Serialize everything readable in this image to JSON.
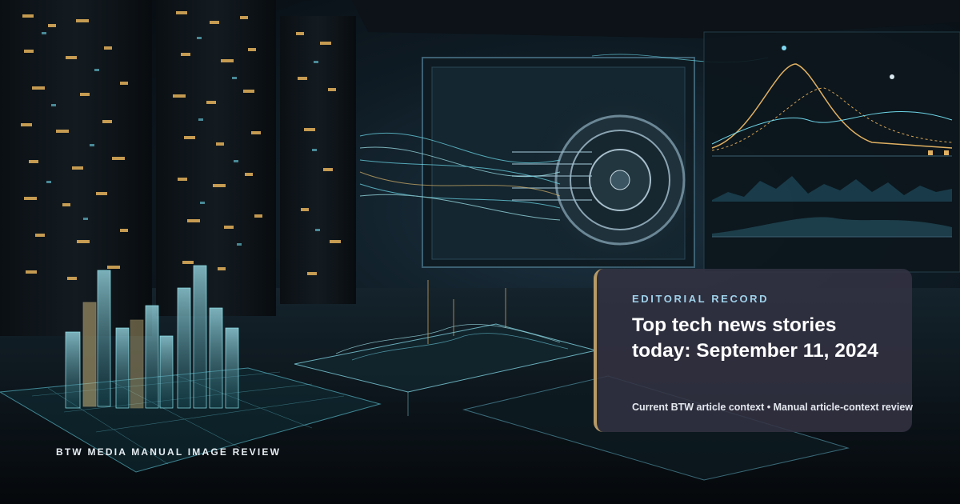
{
  "overlay": {
    "kicker": "BTW MEDIA MANUAL IMAGE REVIEW"
  },
  "card": {
    "eyebrow": "EDITORIAL RECORD",
    "headline": "Top tech news stories today: September 11, 2024",
    "meta": "Current BTW article context • Manual article-context review"
  },
  "colors": {
    "eyebrow": "#9fd2ea",
    "accent_bar": "#b89a66",
    "card_background": "#333242",
    "headline": "#ffffff"
  }
}
